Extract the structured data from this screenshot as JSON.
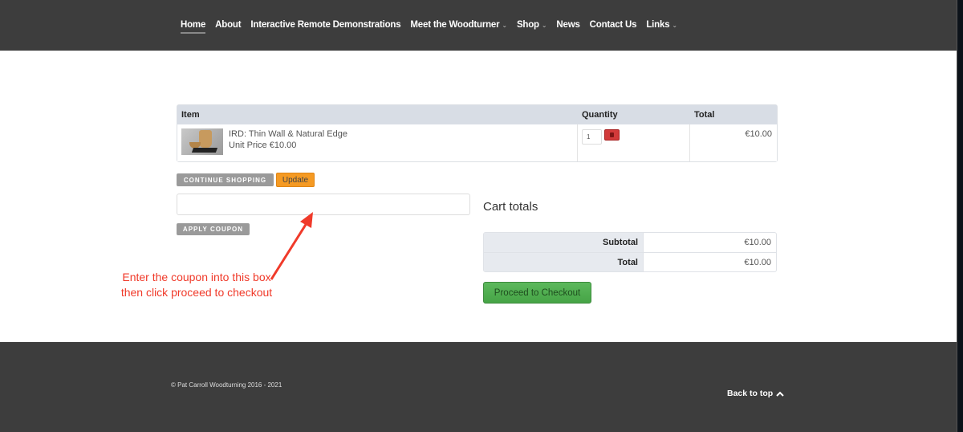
{
  "nav": {
    "items": [
      {
        "label": "Home",
        "active": true,
        "dropdown": false
      },
      {
        "label": "About",
        "active": false,
        "dropdown": false
      },
      {
        "label": "Interactive Remote Demonstrations",
        "active": false,
        "dropdown": false
      },
      {
        "label": "Meet the Woodturner",
        "active": false,
        "dropdown": true
      },
      {
        "label": "Shop",
        "active": false,
        "dropdown": true
      },
      {
        "label": "News",
        "active": false,
        "dropdown": false
      },
      {
        "label": "Contact Us",
        "active": false,
        "dropdown": false
      },
      {
        "label": "Links",
        "active": false,
        "dropdown": true
      }
    ],
    "dropdown_glyph": "⌄"
  },
  "cart": {
    "headers": {
      "item": "Item",
      "quantity": "Quantity",
      "total": "Total"
    },
    "rows": [
      {
        "name": "IRD: Thin Wall & Natural Edge",
        "unit_price": "Unit Price €10.00",
        "quantity": "1",
        "total": "€10.00"
      }
    ],
    "continue_label": "CONTINUE SHOPPING",
    "update_label": "Update",
    "coupon_value": "",
    "apply_coupon_label": "APPLY COUPON"
  },
  "annotation": {
    "text": "Enter the coupon into this box then click proceed to checkout",
    "color": "#f03a2a"
  },
  "totals": {
    "title": "Cart totals",
    "rows": [
      {
        "label": "Subtotal",
        "value": "€10.00"
      },
      {
        "label": "Total",
        "value": "€10.00"
      }
    ],
    "checkout_label": "Proceed to Checkout"
  },
  "footer": {
    "copyright": "© Pat Carroll Woodturning 2016 - 2021",
    "back_to_top": "Back to top"
  }
}
